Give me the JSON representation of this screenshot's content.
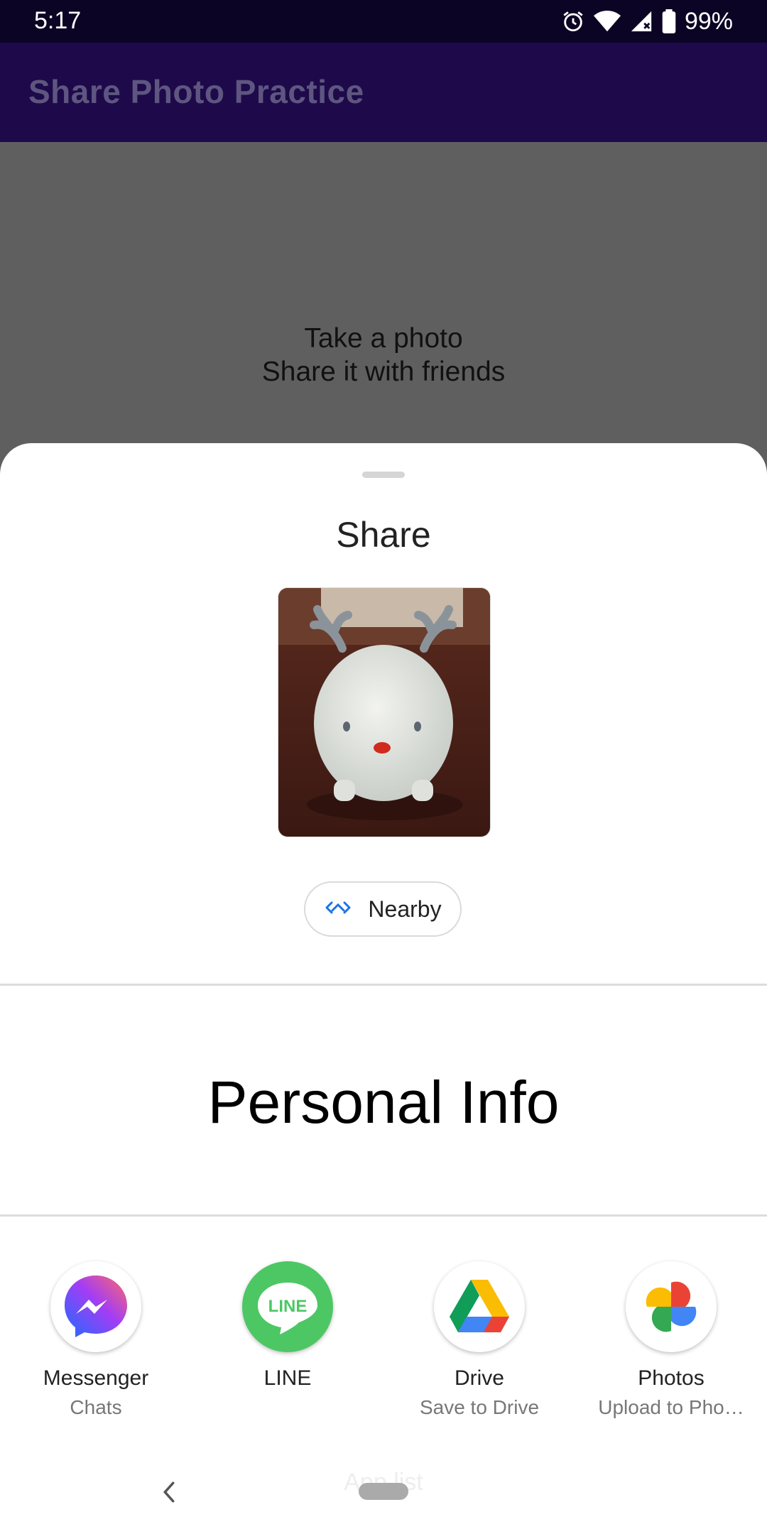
{
  "status_bar": {
    "time": "5:17",
    "battery": "99%"
  },
  "app_bar": {
    "title": "Share Photo Practice"
  },
  "content": {
    "line1": "Take a photo",
    "line2": "Share it with friends"
  },
  "share_sheet": {
    "title": "Share",
    "nearby_label": "Nearby",
    "personal_info": "Personal Info",
    "apps": [
      {
        "name": "Messenger",
        "sub": "Chats",
        "icon": "messenger-icon"
      },
      {
        "name": "LINE",
        "sub": "",
        "icon": "line-icon"
      },
      {
        "name": "Drive",
        "sub": "Save to Drive",
        "icon": "drive-icon"
      },
      {
        "name": "Photos",
        "sub": "Upload to Pho…",
        "icon": "photos-icon"
      }
    ]
  },
  "nav_bar": {
    "faint_text": "App list"
  },
  "colors": {
    "status_bar": "#0b0424",
    "app_bar": "#1e0a4a",
    "scrim": "#5f5f5f",
    "line_green": "#4cc764",
    "nearby_blue": "#1a73e8"
  }
}
